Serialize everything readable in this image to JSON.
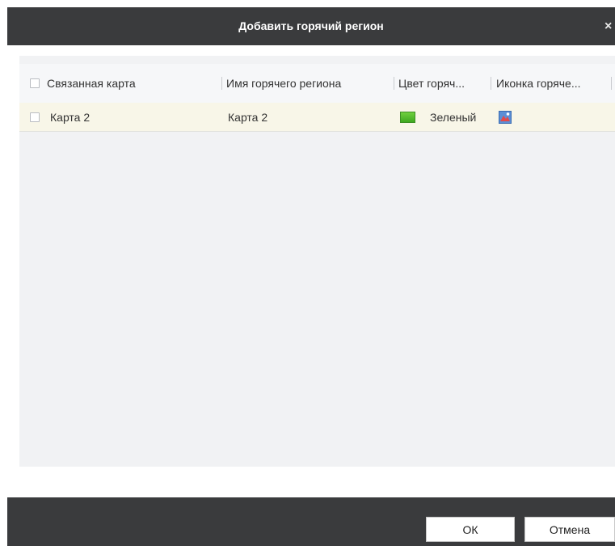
{
  "dialog": {
    "title": "Добавить горячий регион",
    "close_symbol": "×"
  },
  "table": {
    "columns": [
      {
        "label": "Связанная карта"
      },
      {
        "label": "Имя горячего региона"
      },
      {
        "label": "Цвет горяч..."
      },
      {
        "label": "Иконка горяче..."
      }
    ],
    "rows": [
      {
        "linked_map": "Карта 2",
        "hot_region_name": "Карта 2",
        "color_label": "Зеленый",
        "color_hex": "#4cbb2c",
        "icon": "hot-region-icon",
        "checked": false
      }
    ]
  },
  "footer": {
    "ok_label": "ОК",
    "cancel_label": "Отмена"
  },
  "colors": {
    "titlebar_bg": "#3a3b3d",
    "row_highlight": "#f8f6e8",
    "table_bg": "#f1f2f4"
  }
}
